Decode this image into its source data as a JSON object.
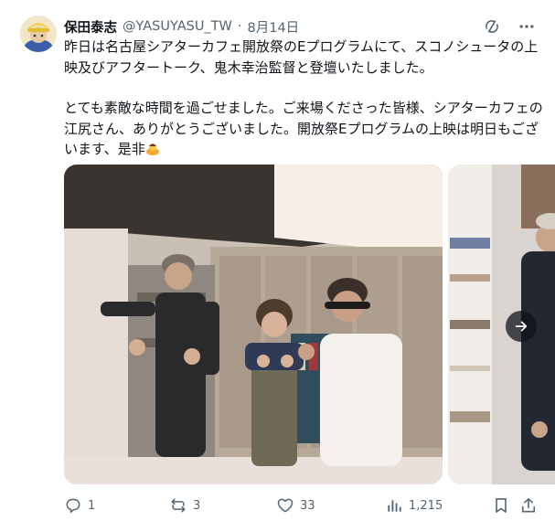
{
  "post": {
    "author_name": "保田泰志",
    "handle": "@YASUYASU_TW",
    "separator": "·",
    "date": "8月14日",
    "paragraph1": "昨日は名古屋シアターカフェ開放祭のEプログラムにて、スコノシュータの上映及びアフタートーク、鬼木幸治監督と登壇いたしました。",
    "paragraph2": "とても素敵な時間を過ごせました。ご来場くださった皆様、シアターカフェの江尻さん、ありがとうございました。開放祭Eプログラムの上映は明日もございます、是非",
    "emoji": "woman-bowing-emoji"
  },
  "header_icons": [
    "grok-icon",
    "more-icon"
  ],
  "actions": {
    "replies": "1",
    "reposts": "3",
    "likes": "33",
    "views": "1,215"
  },
  "colors": {
    "text": "#0f1419",
    "secondary": "#536471",
    "background": "#ffffff"
  }
}
